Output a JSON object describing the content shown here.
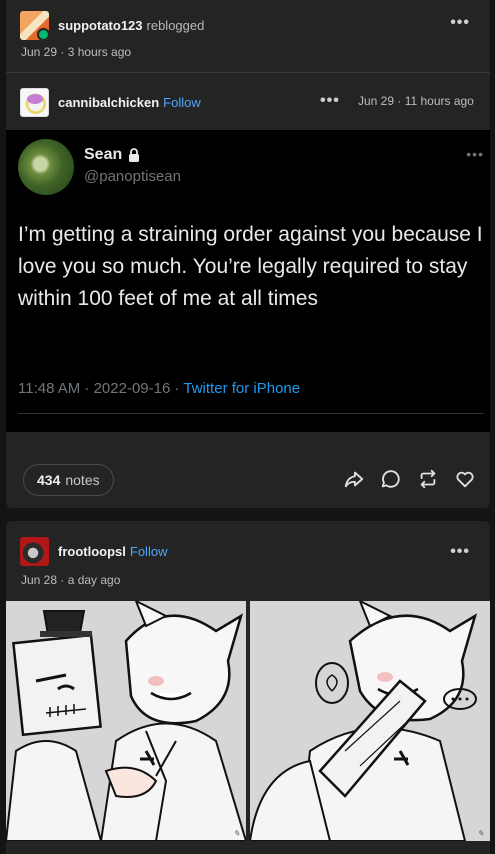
{
  "post1": {
    "reblogger": "suppotato123",
    "reblog_verb": "reblogged",
    "reblog_time": "Jun 29 · 3 hours ago",
    "author": "cannibalchicken",
    "follow_label": "Follow",
    "author_time": "Jun 29 · 11 hours ago",
    "tweet": {
      "name": "Sean",
      "handle": "@panoptisean",
      "text": "I’m getting a straining order against you because I love you so much. You’re legally required to stay within 100 feet of me at all times",
      "time": "11:48 AM · 2022-09-16 · ",
      "source": "Twitter for iPhone"
    },
    "notes_count": "434",
    "notes_label": "notes"
  },
  "post2": {
    "author": "frootloopsl",
    "follow_label": "Follow",
    "time": "Jun 28 · a day ago"
  },
  "icons": [
    "share-icon",
    "reply-icon",
    "reblog-icon",
    "like-icon",
    "more-icon",
    "lock-icon",
    "reblog-badge-icon"
  ],
  "colors": {
    "background": "#141414",
    "card": "#242424",
    "accent": "#4da6ff",
    "twitter_blue": "#1d9bf0",
    "reblog_green": "#00b86b"
  }
}
